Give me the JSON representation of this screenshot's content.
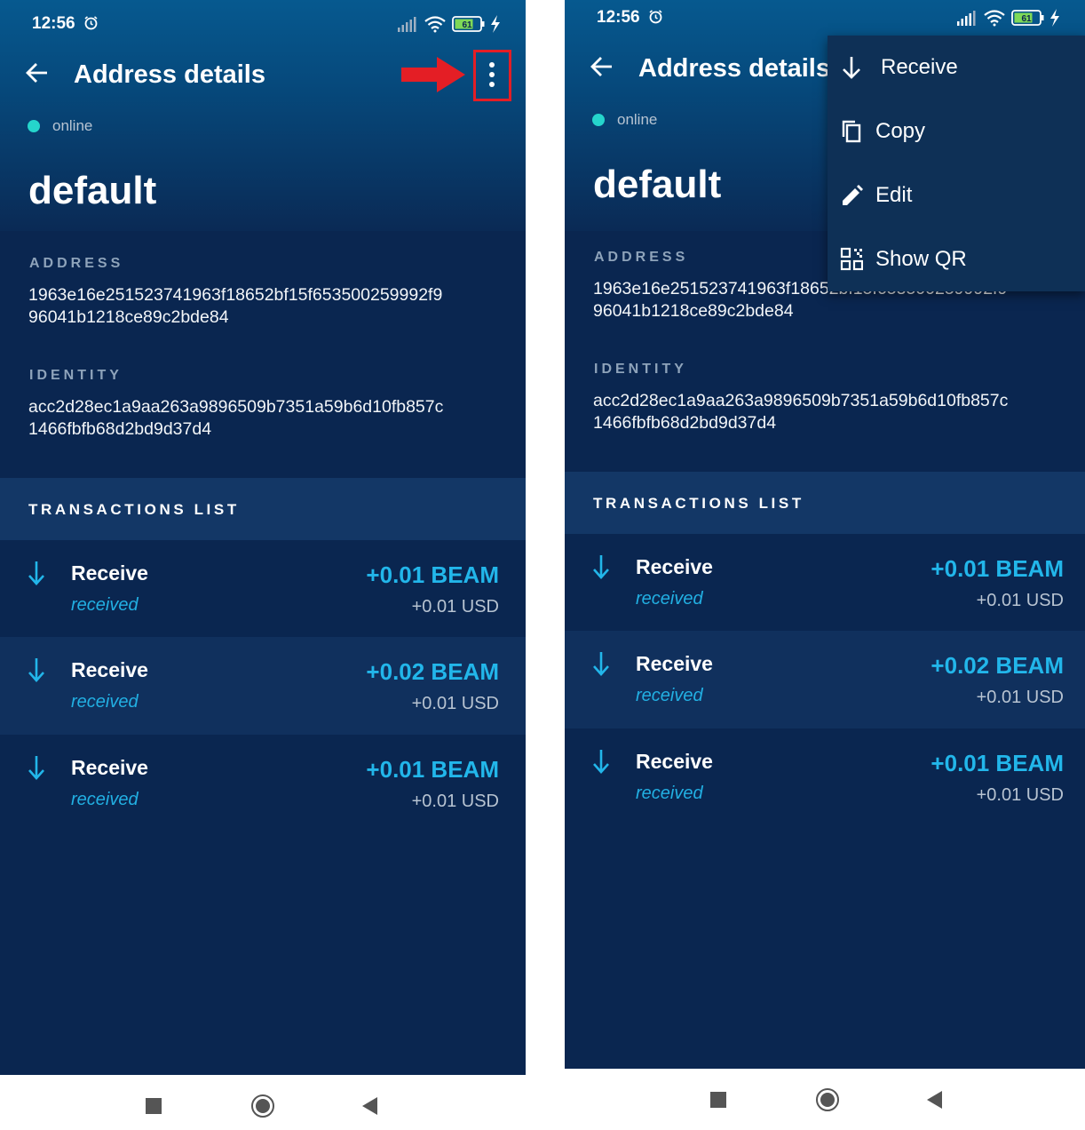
{
  "colors": {
    "background": "#0a2650",
    "accent": "#22b6ea",
    "online": "#25d5cc",
    "row_alt": "#10305d",
    "highlight": "#e41e25"
  },
  "status_bar": {
    "time": "12:56",
    "battery": "61"
  },
  "header": {
    "title": "Address details",
    "menu_icon": "more-vert-icon",
    "back_icon": "arrow-left-icon"
  },
  "status": {
    "text": "online"
  },
  "address_name": "default",
  "address": {
    "label": "ADDRESS",
    "line1": "1963e16e251523741963f18652bf15f653500259992f9",
    "line2": "96041b1218ce89c2bde84"
  },
  "identity": {
    "label": "IDENTITY",
    "line1": "acc2d28ec1a9aa263a9896509b7351a59b6d10fb857c",
    "line2": "1466fbfb68d2bd9d37d4"
  },
  "transactions": {
    "label": "TRANSACTIONS LIST",
    "items": [
      {
        "title": "Receive",
        "status": "received",
        "amount": "+0.01 BEAM",
        "usd": "+0.01 USD"
      },
      {
        "title": "Receive",
        "status": "received",
        "amount": "+0.02 BEAM",
        "usd": "+0.01 USD"
      },
      {
        "title": "Receive",
        "status": "received",
        "amount": "+0.01 BEAM",
        "usd": "+0.01 USD"
      }
    ]
  },
  "menu": {
    "items": [
      {
        "label": "Receive",
        "icon": "arrow-down-icon"
      },
      {
        "label": "Copy",
        "icon": "copy-icon"
      },
      {
        "label": "Edit",
        "icon": "pencil-icon"
      },
      {
        "label": "Show QR",
        "icon": "qr-code-icon"
      }
    ]
  },
  "navigation": {
    "buttons": [
      "recents-square-icon",
      "home-circle-icon",
      "back-triangle-icon"
    ]
  }
}
